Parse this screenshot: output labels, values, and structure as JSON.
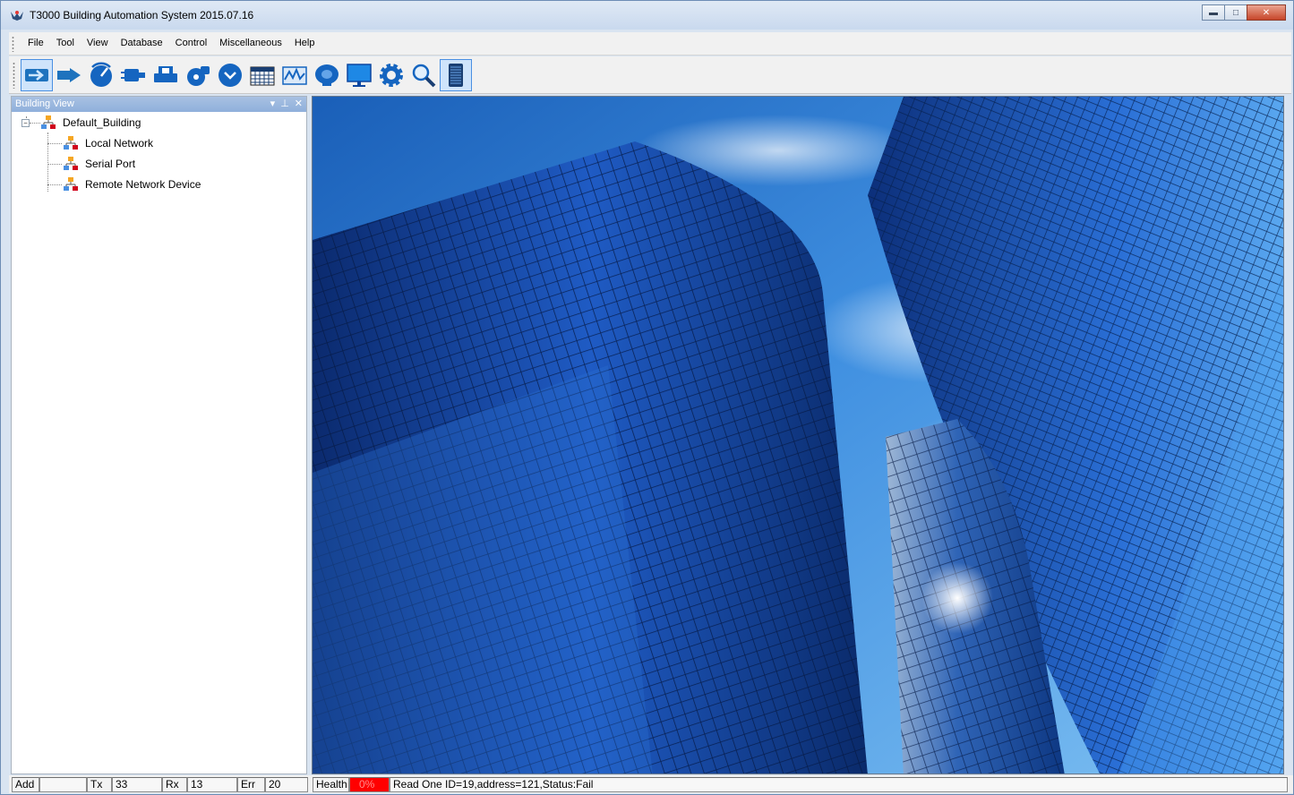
{
  "window": {
    "title": "T3000 Building Automation System 2015.07.16",
    "minimize_label": "▬",
    "maximize_label": "□",
    "close_label": "✕"
  },
  "menu": [
    "File",
    "Tool",
    "View",
    "Database",
    "Control",
    "Miscellaneous",
    "Help"
  ],
  "toolbar": {
    "icons": [
      "connect-icon",
      "disconnect-icon",
      "scan-icon",
      "input-icon",
      "output-icon",
      "variable-icon",
      "program-icon",
      "schedule-icon",
      "graphic-icon",
      "alarm-icon",
      "screen-icon",
      "settings-icon",
      "search-icon",
      "device-icon"
    ],
    "active_index": [
      0,
      13
    ]
  },
  "panel": {
    "title": "Building View",
    "dropdown_icon": "▾",
    "pin_icon": "⊥",
    "close_icon": "✕"
  },
  "tree": {
    "root": "Default_Building",
    "root_expander": "−",
    "children": [
      "Local Network",
      "Serial Port",
      "Remote Network Device"
    ]
  },
  "statusbar": {
    "add_label": "Add",
    "add_value": "",
    "tx_label": "Tx",
    "tx_value": "33",
    "rx_label": "Rx",
    "rx_value": "13",
    "err_label": "Err",
    "err_value": "20",
    "health_label": "Health",
    "health_value": "0%",
    "message": "Read One ID=19,address=121,Status:Fail"
  },
  "colors": {
    "accent": "#4a90e2",
    "panel_header": "#9bb8df",
    "health_bad": "#ff0000"
  }
}
